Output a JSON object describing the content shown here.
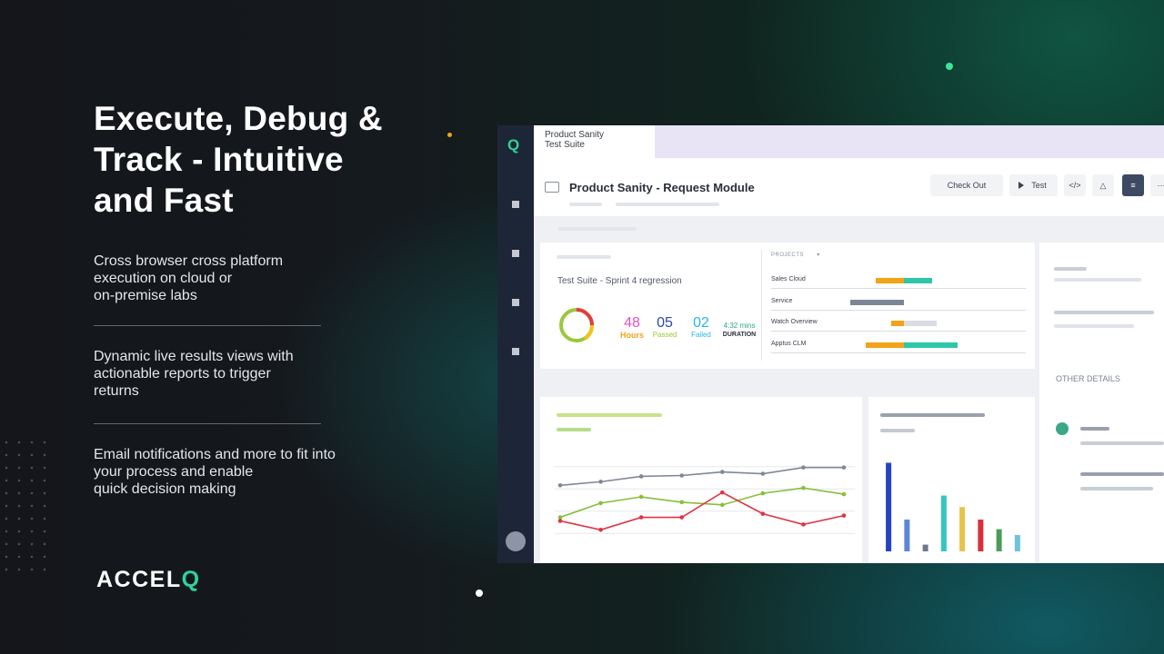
{
  "hero": {
    "headline": "Execute, Debug &\nTrack - Intuitive\nand Fast",
    "features": [
      "Cross browser cross platform\nexecution on cloud or\non-premise labs",
      "Dynamic live results views with\nactionable reports to trigger\nreturns",
      "Email notifications and more to fit into\nyour process and enable\nquick decision making"
    ],
    "logo": {
      "text": "ACCEL",
      "accent": "Q"
    }
  },
  "app": {
    "rail_logo": "Q",
    "tab_label": "Product Sanity\nTest Suite",
    "page_title": "Product Sanity - Request Module",
    "toolbar": {
      "checkout_label": "Check Out",
      "test_label": "Test",
      "code_icon": "</>"
    },
    "summary": {
      "suite_name": "Test Suite - Sprint 4 regression",
      "hours_value": "48",
      "hours_label": "Hours",
      "passed_value": "05",
      "passed_label": "Passed",
      "failed_value": "02",
      "failed_label": "Failed",
      "duration_value": "4:32 mins",
      "duration_label": "DURATION"
    },
    "projects": {
      "header": "PROJECTS",
      "rows": [
        {
          "name": "Sales Cloud",
          "neg": 0.22,
          "pos": 0.22
        },
        {
          "name": "Service",
          "neg": 0.42,
          "pos": 0
        },
        {
          "name": "Watch Overview",
          "neg": 0.1,
          "pos": 0.26
        },
        {
          "name": "Apptus CLM",
          "neg": 0.3,
          "pos": 0.42
        }
      ]
    },
    "other_details_label": "OTHER DETAILS"
  },
  "colors": {
    "accent_green": "#2fd29a",
    "hours": "#e64fc0",
    "passed": "#98c93c",
    "failed": "#25b6e8",
    "duration": "#2aa88c",
    "orange": "#f2a318",
    "teal": "#2dc7a8",
    "slate": "#7a8796"
  },
  "chart_data": [
    {
      "type": "line",
      "x": [
        1,
        2,
        3,
        4,
        5,
        6,
        7,
        8
      ],
      "series": [
        {
          "values": [
            64,
            68,
            74,
            75,
            79,
            77,
            84,
            84
          ],
          "color": "#7f8896"
        },
        {
          "values": [
            28,
            44,
            51,
            45,
            42,
            55,
            61,
            54
          ],
          "color": "#86bf3a"
        },
        {
          "values": [
            24,
            14,
            28,
            28,
            56,
            32,
            20,
            30
          ],
          "color": "#df3344"
        }
      ],
      "ylim": [
        0,
        100
      ]
    },
    {
      "type": "bar",
      "categories": [
        "1",
        "2",
        "3",
        "4",
        "5",
        "6",
        "7",
        "8"
      ],
      "values": [
        92,
        33,
        7,
        58,
        46,
        33,
        23,
        17
      ],
      "colors": [
        "#2343c4",
        "#5b87d8",
        "#6b7b8c",
        "#36c6c2",
        "#e6c34a",
        "#d8303a",
        "#4a9c5a",
        "#6fc3d8"
      ],
      "ylim": [
        0,
        100
      ]
    }
  ]
}
